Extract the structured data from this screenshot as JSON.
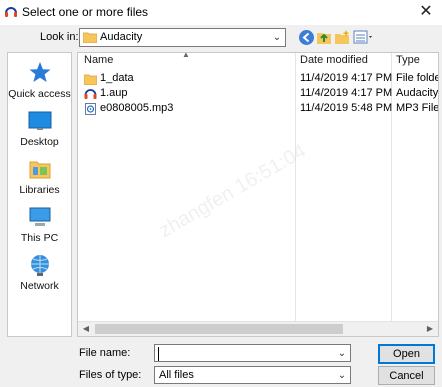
{
  "window": {
    "title": "Select one or more files",
    "close_glyph": "✕"
  },
  "look_in": {
    "label": "Look in:",
    "value": "Audacity"
  },
  "places": [
    {
      "label": "Quick access",
      "icon": "star-icon"
    },
    {
      "label": "Desktop",
      "icon": "desktop-icon"
    },
    {
      "label": "Libraries",
      "icon": "libraries-icon"
    },
    {
      "label": "This PC",
      "icon": "computer-icon"
    },
    {
      "label": "Network",
      "icon": "network-icon"
    }
  ],
  "file_list": {
    "columns": [
      "Name",
      "Date modified",
      "Type"
    ],
    "rows": [
      {
        "name": "1_data",
        "date": "11/4/2019 4:17 PM",
        "type": "File folder",
        "icon": "folder-icon"
      },
      {
        "name": "1.aup",
        "date": "11/4/2019 4:17 PM",
        "type": "Audacity I",
        "icon": "audacity-file-icon"
      },
      {
        "name": "e0808005.mp3",
        "date": "11/4/2019 5:48 PM",
        "type": "MP3 File",
        "icon": "mp3-file-icon"
      }
    ]
  },
  "file_name": {
    "label": "File name:",
    "value": ""
  },
  "files_of_type": {
    "label": "Files of type:",
    "value": "All files"
  },
  "buttons": {
    "open": "Open",
    "cancel": "Cancel"
  },
  "watermark": {
    "text": "zhangfen 16:51:04"
  },
  "colors": {
    "accent": "#0078d7",
    "folder": "#f6c55b"
  }
}
